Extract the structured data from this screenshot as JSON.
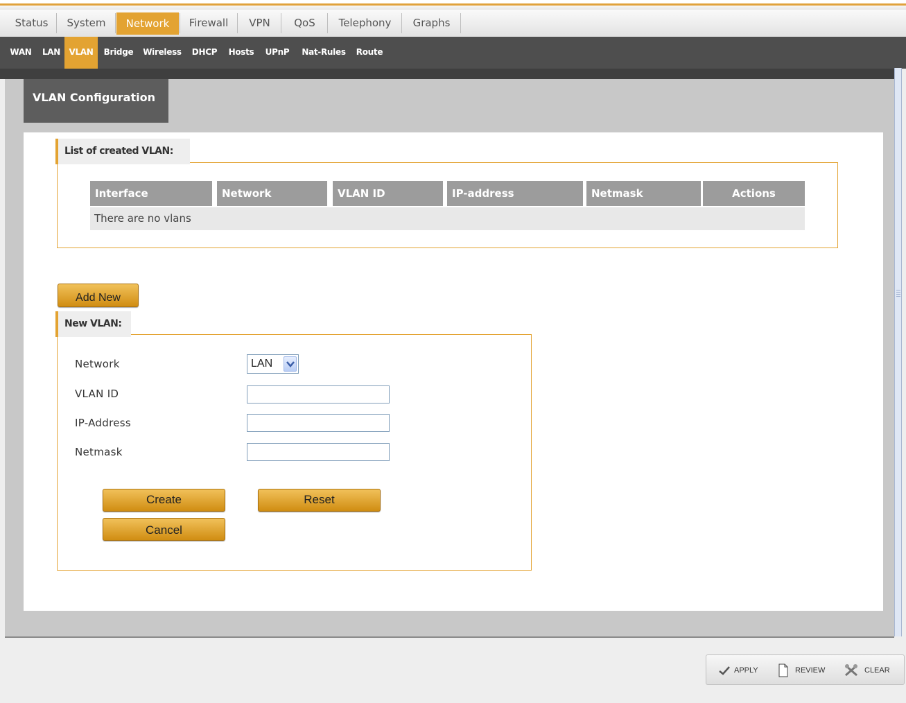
{
  "colors": {
    "accent": "#e3a332",
    "submenu_bg": "#4e4e4e",
    "header_cell_bg": "#9c9c9c"
  },
  "main_menu": [
    "Status",
    "System",
    "Network",
    "Firewall",
    "VPN",
    "QoS",
    "Telephony",
    "Graphs"
  ],
  "main_menu_active": "Network",
  "sub_menu": [
    "WAN",
    "LAN",
    "VLAN",
    "Bridge",
    "Wireless",
    "DHCP",
    "Hosts",
    "UPnP",
    "Nat-Rules",
    "Route"
  ],
  "sub_menu_active": "VLAN",
  "page_title": "VLAN Configuration",
  "list_section": {
    "legend": "List of created VLAN:",
    "columns": [
      "Interface",
      "Network",
      "VLAN ID",
      "IP-address",
      "Netmask",
      "Actions"
    ],
    "empty_message": "There are no vlans"
  },
  "add_new_label": "Add New",
  "new_section": {
    "legend": "New VLAN:",
    "network_label": "Network",
    "network_value": "LAN",
    "vlan_id_label": "VLAN ID",
    "vlan_id_value": "",
    "ip_label": "IP-Address",
    "ip_value": "",
    "netmask_label": "Netmask",
    "netmask_value": "",
    "create_label": "Create",
    "reset_label": "Reset",
    "cancel_label": "Cancel"
  },
  "footer": {
    "apply": "APPLY",
    "review": "REVIEW",
    "clear": "CLEAR"
  },
  "icons": {
    "apply": "checkmark-icon",
    "review": "document-icon",
    "clear": "clear-icon",
    "select": "chevron-down-icon"
  }
}
